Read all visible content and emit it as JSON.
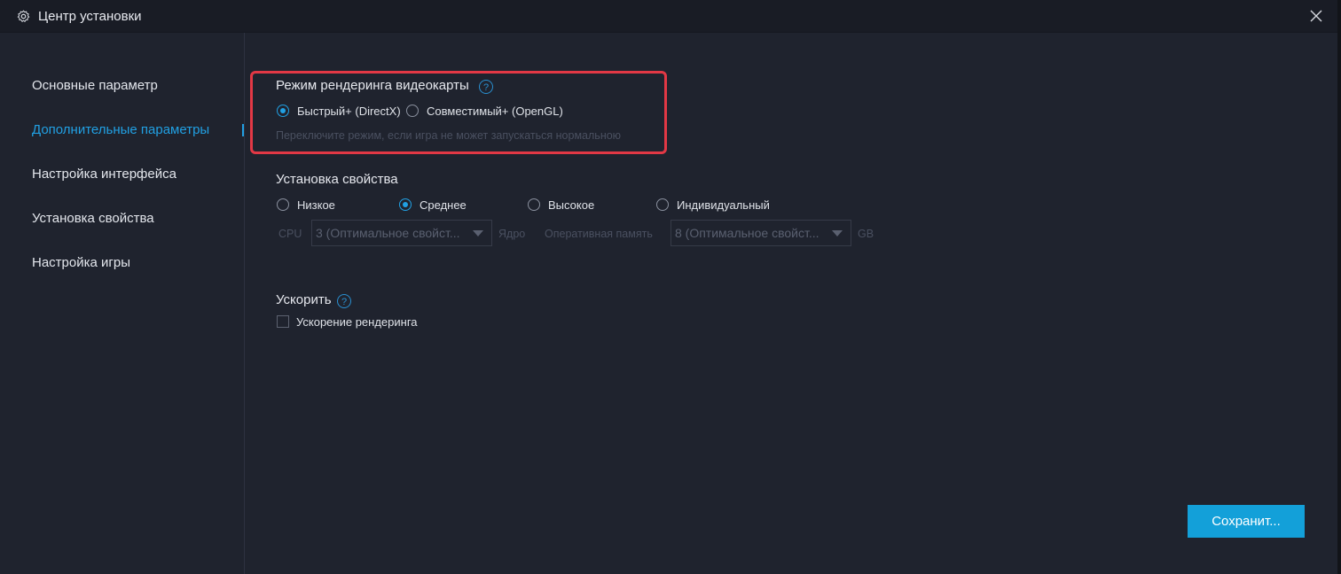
{
  "window": {
    "title": "Центр установки",
    "icon": "gear-icon",
    "close_icon": "close-icon"
  },
  "sidebar": {
    "items": [
      {
        "label": "Основные параметр",
        "active": false
      },
      {
        "label": "Дополнительные параметры",
        "active": true
      },
      {
        "label": "Настройка интерфейса",
        "active": false
      },
      {
        "label": "Установка свойства",
        "active": false
      },
      {
        "label": "Настройка игры",
        "active": false
      }
    ]
  },
  "render_mode": {
    "title": "Режим рендеринга видеокарты",
    "help": "?",
    "options": [
      {
        "label": "Быстрый+ (DirectX)",
        "checked": true
      },
      {
        "label": "Совместимый+ (OpenGL)",
        "checked": false
      }
    ],
    "hint": "Переключите режим, если игра не может запускаться нормальною"
  },
  "property": {
    "title": "Установка свойства",
    "options": [
      {
        "label": "Низкое",
        "checked": false
      },
      {
        "label": "Среднее",
        "checked": true
      },
      {
        "label": "Высокое",
        "checked": false
      },
      {
        "label": "Индивидуальный",
        "checked": false
      }
    ],
    "cpu_label": "CPU",
    "cpu_value": "3 (Оптимальное свойст...",
    "cpu_unit": "Ядро",
    "ram_label": "Оперативная память",
    "ram_value": "8 (Оптимальное свойст...",
    "ram_unit": "GB"
  },
  "accelerate": {
    "title": "Ускорить",
    "help": "?",
    "checkbox_label": "Ускорение рендеринга",
    "checked": false
  },
  "actions": {
    "save_label": "Сохранит..."
  },
  "colors": {
    "accent": "#21a0e3",
    "button": "#13a0d9",
    "highlight": "#e23845",
    "background": "#1f232e"
  }
}
